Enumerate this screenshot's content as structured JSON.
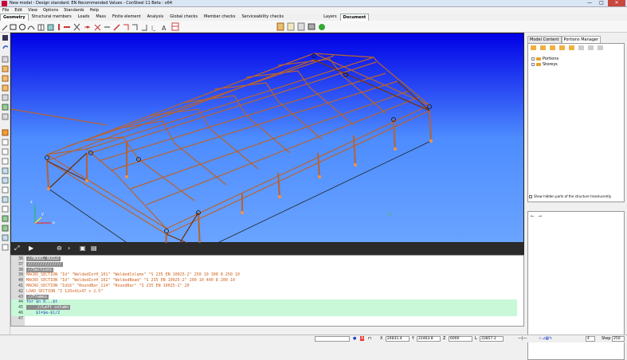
{
  "window": {
    "title": "New model - Design standard: EN Recommended Values - ConSteel 11 Beta - x64",
    "min": "—",
    "max": "□",
    "close": "✕"
  },
  "menu": [
    "File",
    "Edit",
    "View",
    "Options",
    "Standards",
    "Help"
  ],
  "ribbon_tabs": [
    "Geometry",
    "Structural members",
    "Loads",
    "Mass",
    "Finite element",
    "Analysis",
    "Global checks",
    "Member checks",
    "Serviceability checks"
  ],
  "ribbon_tabs_right": [
    "Layers",
    "Document"
  ],
  "active_tab": "Geometry",
  "right_panel": {
    "tabs": [
      "Model Content",
      "Portions Manager"
    ],
    "tree": [
      "Portions",
      "Storeys"
    ],
    "checkbox_label": "Show hidden parts of the structure translucently"
  },
  "editor": {
    "lines": [
      {
        "n": "36",
        "text": "//MODEL BUILD",
        "cls": "c-comment"
      },
      {
        "n": "37",
        "text": "//////////////",
        "cls": "c-comment"
      },
      {
        "n": "38",
        "text": "//Sections",
        "cls": "c-comment"
      },
      {
        "n": "39",
        "text": "MACRO_SECTION \"Id\" \"WeldedIorH_101\" \"WeldedColumn\" \"S 235 EN 10025-2\" 250 10 300 8 250 10",
        "cls": "c-macro"
      },
      {
        "n": "40",
        "text": "MACRO_SECTION \"Id\" \"WeldedIorH_102\" \"WeldedBeam\" \"S 235 EN 10025-2\" 200 10 400 8 200 10",
        "cls": "c-macro"
      },
      {
        "n": "41",
        "text": "MACRO_SECTION \"Id16\" \"RoundBar_114\" \"RoundBar\" \"S 235 EN 10025-2\" 20",
        "cls": "c-macro"
      },
      {
        "n": "42",
        "text": "LOAD_SECTION \"Z 120x41x47 x 2.5\"",
        "cls": "c-macro"
      },
      {
        "n": "43",
        "text": "//Frames",
        "cls": "c-comment"
      },
      {
        "n": "44",
        "text": "for $n 0...$t",
        "cls": "c-kw"
      },
      {
        "n": "45",
        "text": "    //Left column",
        "cls": "c-comment"
      },
      {
        "n": "46",
        "text": "    $l=$e-$l/2",
        "cls": "c-kw"
      },
      {
        "n": "47",
        "text": "",
        "cls": ""
      }
    ]
  },
  "status": {
    "x_label": "X",
    "x_value": "24831.4",
    "y_label": "Y",
    "y_value": "22463.8",
    "z_label": "Z",
    "z_value": "6000",
    "l_label": "L",
    "l_value": "33857.3",
    "n_value": "4",
    "step_label": "Step",
    "step_value": "250"
  },
  "axes": {
    "z": "z",
    "x": "x",
    "y": "y"
  }
}
